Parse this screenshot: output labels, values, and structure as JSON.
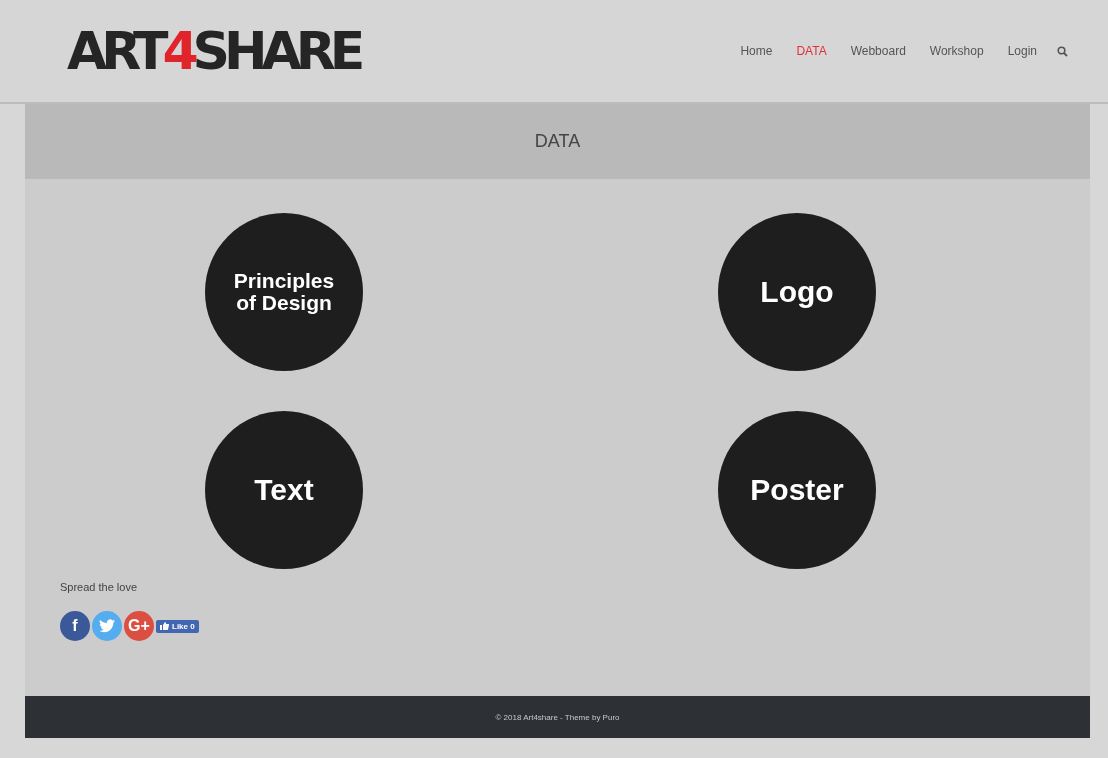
{
  "logo": {
    "before": "ART",
    "accent": "4",
    "after": "SHARE"
  },
  "nav": [
    {
      "label": "Home",
      "selected": false
    },
    {
      "label": "DATA",
      "selected": true
    },
    {
      "label": "Webboard",
      "selected": false
    },
    {
      "label": "Workshop",
      "selected": false
    },
    {
      "label": "Login",
      "selected": false
    }
  ],
  "page_title": "DATA",
  "categories": [
    {
      "label": "Principles of Design"
    },
    {
      "label": "Logo"
    },
    {
      "label": "Text"
    },
    {
      "label": "Poster"
    }
  ],
  "share": {
    "heading": "Spread the love",
    "buttons": [
      {
        "kind": "facebook",
        "label": "f"
      },
      {
        "kind": "twitter"
      },
      {
        "kind": "google",
        "label": "G+"
      }
    ],
    "like": "Like 0"
  },
  "footer": "© 2018 Art4share - Theme by Puro"
}
